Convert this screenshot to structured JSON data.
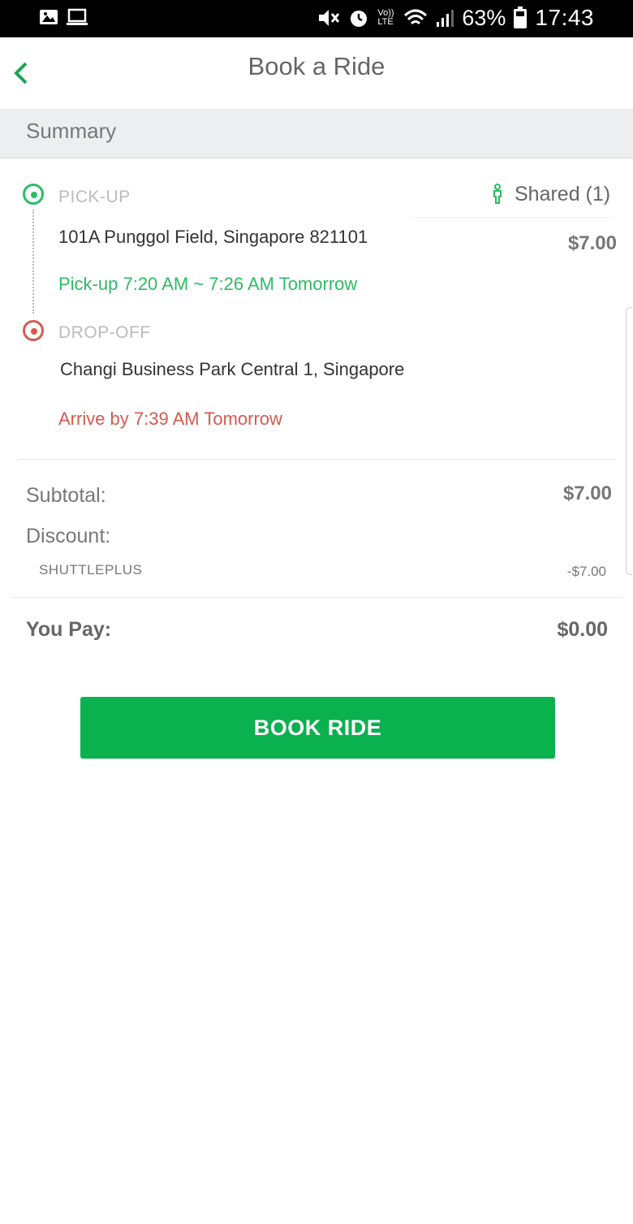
{
  "status_bar": {
    "battery_percent": "63%",
    "time": "17:43",
    "volte_label": "Vo)) LTE",
    "icons_left": [
      "image-icon",
      "laptop-icon"
    ],
    "icons_right": [
      "mute-icon",
      "alarm-icon",
      "volte-icon",
      "wifi-icon",
      "signal-icon",
      "battery-icon"
    ]
  },
  "header": {
    "title": "Book a Ride",
    "back_icon": "chevron-left-icon"
  },
  "summary": {
    "label": "Summary"
  },
  "trip": {
    "pickup": {
      "label": "PICK-UP",
      "address": "101A Punggol Field, Singapore 821101",
      "time": "Pick-up 7:20 AM ~ 7:26 AM Tomorrow"
    },
    "dropoff": {
      "label": "DROP-OFF",
      "address": "Changi Business Park Central 1, Singapore",
      "time": "Arrive by 7:39 AM Tomorrow"
    },
    "ride_type": "Shared (1)",
    "price": "$7.00"
  },
  "totals": {
    "subtotal_label": "Subtotal:",
    "subtotal_value": "$7.00",
    "discount_label": "Discount:",
    "discount_code": "SHUTTLEPLUS",
    "discount_value": "-$7.00",
    "you_pay_label": "You Pay:",
    "you_pay_value": "$0.00"
  },
  "actions": {
    "book_label": "BOOK RIDE"
  },
  "colors": {
    "accent_green": "#0bb04f",
    "pickup_green": "#2dbb64",
    "dropoff_red": "#d55a4e"
  }
}
